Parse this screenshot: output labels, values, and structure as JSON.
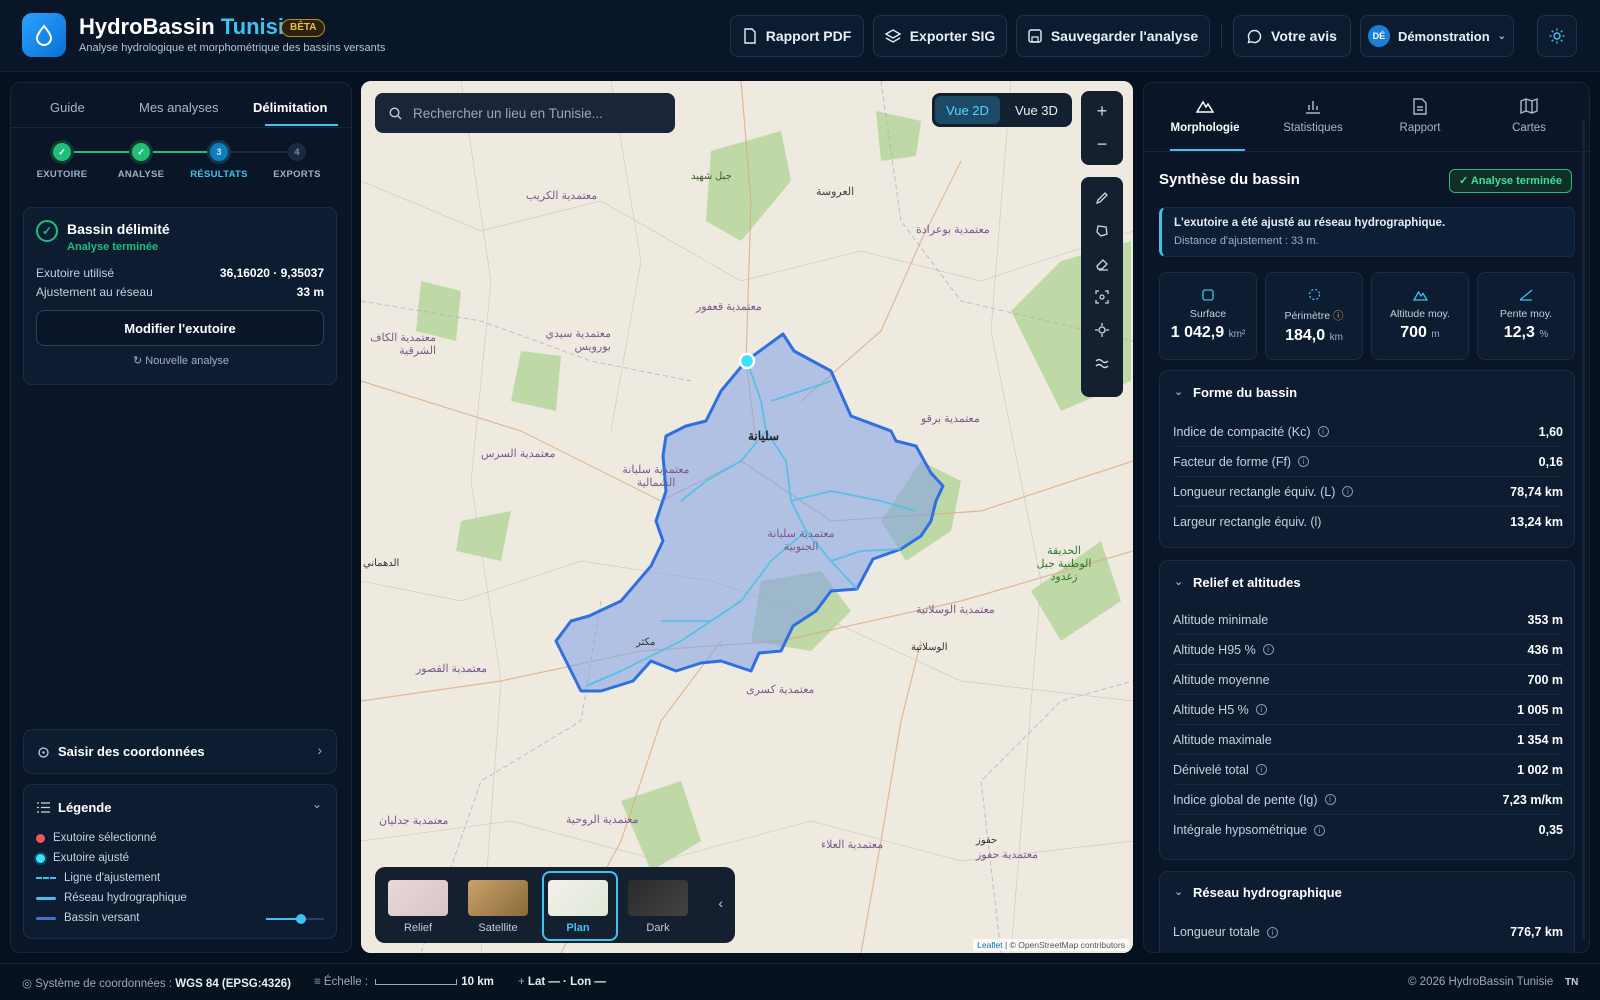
{
  "header": {
    "title_main": "HydroBassin",
    "title_accent": "Tunisie",
    "badge": "BÊTA",
    "subtitle": "Analyse hydrologique et morphométrique des bassins versants",
    "buttons": {
      "pdf": "Rapport PDF",
      "sig": "Exporter SIG",
      "save": "Sauvegarder l'analyse",
      "feedback": "Votre avis"
    },
    "user": {
      "initials": "DÉ",
      "name": "Démonstration"
    }
  },
  "left": {
    "tabs": [
      "Guide",
      "Mes analyses",
      "Délimitation"
    ],
    "active_tab": "Délimitation",
    "steps": [
      {
        "num": "✓",
        "label": "EXUTOIRE",
        "state": "done"
      },
      {
        "num": "✓",
        "label": "ANALYSE",
        "state": "done"
      },
      {
        "num": "3",
        "label": "RÉSULTATS",
        "state": "current"
      },
      {
        "num": "4",
        "label": "EXPORTS",
        "state": "todo"
      }
    ],
    "result": {
      "title": "Bassin délimité",
      "status": "Analyse terminée",
      "outlet_label": "Exutoire utilisé",
      "outlet_value": "36,16020 · 9,35037",
      "adjust_label": "Ajustement au réseau",
      "adjust_value": "33 m",
      "modify_button": "Modifier l'exutoire",
      "new_analysis": "Nouvelle analyse"
    },
    "coords_card": "Saisir des coordonnées",
    "legend": {
      "title": "Légende",
      "items": [
        {
          "label": "Exutoire sélectionné",
          "color": "#f0555a"
        },
        {
          "label": "Exutoire ajusté",
          "color": "#3ee0ff"
        },
        {
          "label": "Ligne d'ajustement",
          "color": "#3ec3f0"
        },
        {
          "label": "Réseau hydrographique",
          "color": "#3ec3f0"
        },
        {
          "label": "Bassin versant",
          "color": "#4a6fc8"
        }
      ],
      "opacity": 0.6
    }
  },
  "map": {
    "search_placeholder": "Rechercher un lieu en Tunisie...",
    "view_2d": "Vue 2D",
    "view_3d": "Vue 3D",
    "zoom_in": "+",
    "zoom_out": "−",
    "layers": [
      "Relief",
      "Satellite",
      "Plan",
      "Dark"
    ],
    "active_layer": "Plan",
    "attribution_leaflet": "Leaflet",
    "attribution_osm": "| © OpenStreetMap contributors",
    "places": [
      {
        "name": "معتمدية الكريب"
      },
      {
        "name": "جبل شهيد"
      },
      {
        "name": "العروسة"
      },
      {
        "name": "معتمدية بوعرادة"
      },
      {
        "name": "معتمدية قعفور"
      },
      {
        "name": "معتمدية الكاف الشرقية"
      },
      {
        "name": "معتمدية سيدي بورويس"
      },
      {
        "name": "سليانة"
      },
      {
        "name": "معتمدية برقو"
      },
      {
        "name": "معتمدية السرس"
      },
      {
        "name": "معتمدية سليانة الشمالية"
      },
      {
        "name": "معتمدية سليانة الجنوبية"
      },
      {
        "name": "الدهماني"
      },
      {
        "name": "الحديقة الوطنية جبل زغدود"
      },
      {
        "name": "معتمدية الوسلاتية"
      },
      {
        "name": "الوسلاتية"
      },
      {
        "name": "مكثر"
      },
      {
        "name": "معتمدية القصور"
      },
      {
        "name": "معتمدية كسرى"
      },
      {
        "name": "معتمدية الروحية"
      },
      {
        "name": "معتمدية جدليان"
      },
      {
        "name": "معتمدية العلاء"
      },
      {
        "name": "حفوز"
      },
      {
        "name": "معتمدية حفوز"
      }
    ]
  },
  "right": {
    "tabs": [
      "Morphologie",
      "Statistiques",
      "Rapport",
      "Cartes"
    ],
    "active_tab": "Morphologie",
    "summary_title": "Synthèse du bassin",
    "done_badge": "✓ Analyse terminée",
    "notice_title": "L'exutoire a été ajusté au réseau hydrographique.",
    "notice_detail": "Distance d'ajustement : 33 m.",
    "metrics": [
      {
        "label": "Surface",
        "value": "1 042,9",
        "unit": "km²"
      },
      {
        "label": "Périmètre",
        "value": "184,0",
        "unit": "km"
      },
      {
        "label": "Altitude moy.",
        "value": "700",
        "unit": "m"
      },
      {
        "label": "Pente moy.",
        "value": "12,3",
        "unit": "%"
      }
    ],
    "forme": {
      "title": "Forme du bassin",
      "rows": [
        {
          "k": "Indice de compacité (Kc)",
          "v": "1,60"
        },
        {
          "k": "Facteur de forme (Ff)",
          "v": "0,16"
        },
        {
          "k": "Longueur rectangle équiv. (L)",
          "v": "78,74 km"
        },
        {
          "k": "Largeur rectangle équiv. (l)",
          "v": "13,24 km"
        }
      ]
    },
    "relief": {
      "title": "Relief et altitudes",
      "rows": [
        {
          "k": "Altitude minimale",
          "v": "353 m"
        },
        {
          "k": "Altitude H95 %",
          "v": "436 m"
        },
        {
          "k": "Altitude moyenne",
          "v": "700 m"
        },
        {
          "k": "Altitude H5 %",
          "v": "1 005 m"
        },
        {
          "k": "Altitude maximale",
          "v": "1 354 m"
        },
        {
          "k": "Dénivelé total",
          "v": "1 002 m"
        },
        {
          "k": "Indice global de pente (Ig)",
          "v": "7,23 m/km"
        },
        {
          "k": "Intégrale hypsométrique",
          "v": "0,35"
        }
      ]
    },
    "reseau": {
      "title": "Réseau hydrographique",
      "rows": [
        {
          "k": "Longueur totale",
          "v": "776,7 km"
        }
      ]
    }
  },
  "status": {
    "crs_label": "Système de coordonnées :",
    "crs_value": "WGS 84 (EPSG:4326)",
    "scale_label": "Échelle :",
    "scale_value": "10 km",
    "latlon": "Lat — · Lon —",
    "copyright": "© 2026 HydroBassin Tunisie",
    "locale": "TN"
  },
  "colors": {
    "accent": "#3ec3f0",
    "success": "#1fbf7a",
    "basin_fill": "#7f9ee8",
    "basin_stroke": "#2f6fe0"
  }
}
